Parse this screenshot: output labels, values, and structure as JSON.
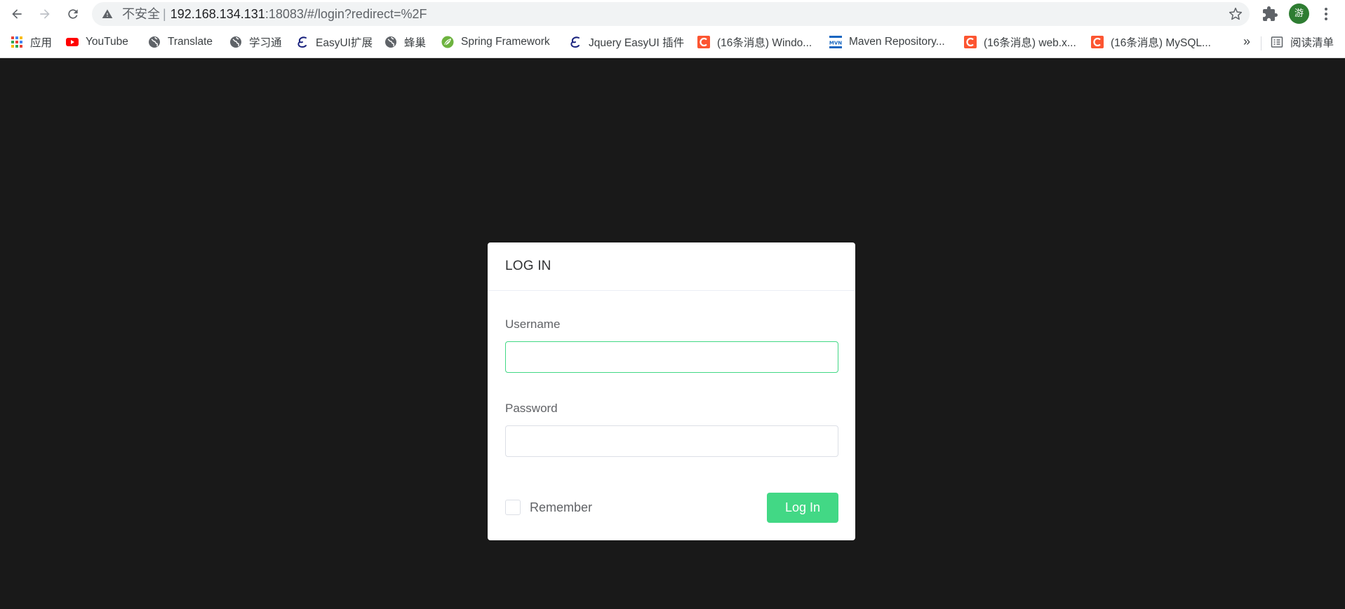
{
  "browser": {
    "address_bar": {
      "security_label": "不安全",
      "separator": "|",
      "host": "192.168.134.131",
      "path": ":18083/#/login?redirect=%2F"
    },
    "profile_avatar": "游",
    "bookmarks": [
      {
        "label": "应用",
        "icon": "apps-grid-icon"
      },
      {
        "label": "YouTube",
        "icon": "youtube-icon"
      },
      {
        "label": "Translate",
        "icon": "globe-icon"
      },
      {
        "label": "学习通",
        "icon": "globe-icon"
      },
      {
        "label": "EasyUI扩展",
        "icon": "easyui-icon"
      },
      {
        "label": "蜂巢",
        "icon": "globe-icon"
      },
      {
        "label": "Spring Framework",
        "icon": "spring-leaf-icon"
      },
      {
        "label": "Jquery EasyUI 插件",
        "icon": "easyui-icon"
      },
      {
        "label": "(16条消息) Windo...",
        "icon": "csdn-icon"
      },
      {
        "label": "Maven Repository...",
        "icon": "mvn-icon"
      },
      {
        "label": "(16条消息) web.x...",
        "icon": "csdn-icon"
      },
      {
        "label": "(16条消息) MySQL...",
        "icon": "csdn-icon"
      }
    ],
    "bookmarks_overflow": "»",
    "reading_list": "阅读清单"
  },
  "login": {
    "title": "LOG IN",
    "username_label": "Username",
    "username_value": "",
    "password_label": "Password",
    "password_value": "",
    "remember_label": "Remember",
    "remember_checked": false,
    "submit_label": "Log In"
  },
  "colors": {
    "page_background": "#191919",
    "accent": "#42d885",
    "card_background": "#ffffff",
    "csdn_red": "#fc5531",
    "youtube_red": "#ff0000"
  }
}
